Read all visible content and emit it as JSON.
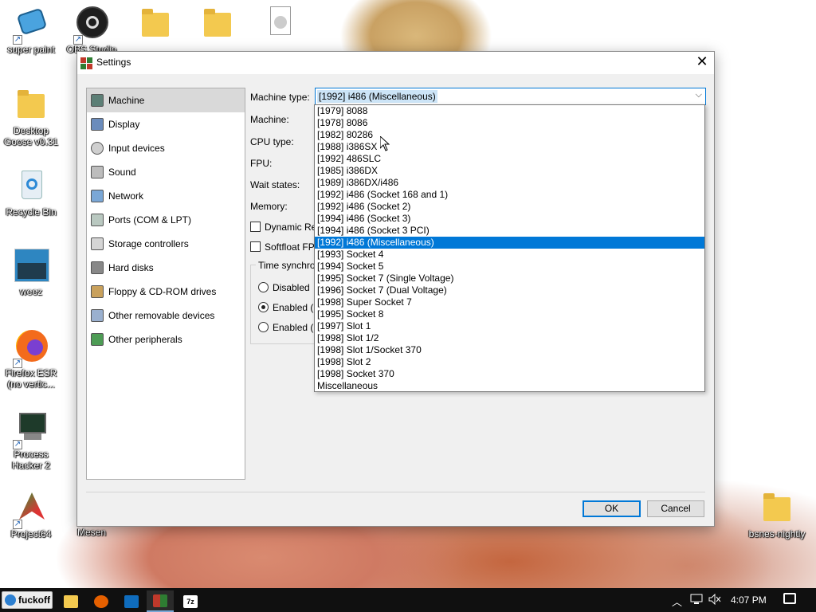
{
  "desktop": {
    "icons": [
      {
        "label": "super paint"
      },
      {
        "label": "OBS Studio"
      },
      {
        "label": ""
      },
      {
        "label": ""
      },
      {
        "label": ""
      },
      {
        "label": "Desktop Goose v0.31"
      },
      {
        "label": "Recycle Bin"
      },
      {
        "label": "weez"
      },
      {
        "label": "Firefox ESR (no vertic..."
      },
      {
        "label": "Process Hacker 2"
      },
      {
        "label": "Project64"
      },
      {
        "label": "Mesen"
      },
      {
        "label": "bsnes-nightly"
      }
    ]
  },
  "dialog": {
    "title": "Settings",
    "close_glyph": "✕",
    "categories": [
      {
        "label": "Machine",
        "icon": "machine-icon",
        "selected": true
      },
      {
        "label": "Display",
        "icon": "display-icon"
      },
      {
        "label": "Input devices",
        "icon": "input-devices-icon"
      },
      {
        "label": "Sound",
        "icon": "sound-icon"
      },
      {
        "label": "Network",
        "icon": "network-icon"
      },
      {
        "label": "Ports (COM & LPT)",
        "icon": "ports-icon"
      },
      {
        "label": "Storage controllers",
        "icon": "storage-controllers-icon"
      },
      {
        "label": "Hard disks",
        "icon": "hard-disks-icon"
      },
      {
        "label": "Floppy & CD-ROM drives",
        "icon": "floppy-cdrom-icon"
      },
      {
        "label": "Other removable devices",
        "icon": "removable-devices-icon"
      },
      {
        "label": "Other peripherals",
        "icon": "other-peripherals-icon"
      }
    ],
    "machine": {
      "machine_type_label": "Machine type:",
      "machine_type_value": "[1992] i486 (Miscellaneous)",
      "machine_label": "Machine:",
      "cpu_type_label": "CPU type:",
      "fpu_label": "FPU:",
      "wait_states_label": "Wait states:",
      "memory_label": "Memory:",
      "dynamic_recompiler_label": "Dynamic Re",
      "softfloat_label": "Softfloat FP",
      "time_sync_group_label": "Time synchro",
      "time_sync_options": [
        "Disabled",
        "Enabled (l",
        "Enabled (U"
      ],
      "time_sync_selected": 1
    },
    "dropdown_options": [
      "[1979] 8088",
      "[1978] 8086",
      "[1982] 80286",
      "[1988] i386SX",
      "[1992] 486SLC",
      "[1985] i386DX",
      "[1989] i386DX/i486",
      "[1992] i486 (Socket 168 and 1)",
      "[1992] i486 (Socket 2)",
      "[1994] i486 (Socket 3)",
      "[1994] i486 (Socket 3 PCI)",
      "[1992] i486 (Miscellaneous)",
      "[1993] Socket 4",
      "[1994] Socket 5",
      "[1995] Socket 7 (Single Voltage)",
      "[1996] Socket 7 (Dual Voltage)",
      "[1998] Super Socket 7",
      "[1995] Socket 8",
      "[1997] Slot 1",
      "[1998] Slot 1/2",
      "[1998] Slot 1/Socket 370",
      "[1998] Slot 2",
      "[1998] Socket 370",
      "Miscellaneous"
    ],
    "dropdown_highlighted": 11,
    "ok_label": "OK",
    "cancel_label": "Cancel",
    "chevron_glyph": "⌵"
  },
  "taskbar": {
    "start_label": "fuckoff",
    "apps": [
      {
        "name": "file-explorer-icon",
        "color": "#f3c94f"
      },
      {
        "name": "firefox-icon",
        "color": "#e66000"
      },
      {
        "name": "outlook-icon",
        "color": "#0f6cbd"
      },
      {
        "name": "86box-icon",
        "color": "#c0392b",
        "active": true
      },
      {
        "name": "7zip-icon",
        "color": "#ffffff"
      }
    ],
    "tray": {
      "up_glyph": "︿",
      "time": "4:07 PM"
    }
  },
  "colors": {
    "accent": "#0078d7",
    "taskbar": "#101010",
    "dialog_bg": "#f0f0f0"
  }
}
